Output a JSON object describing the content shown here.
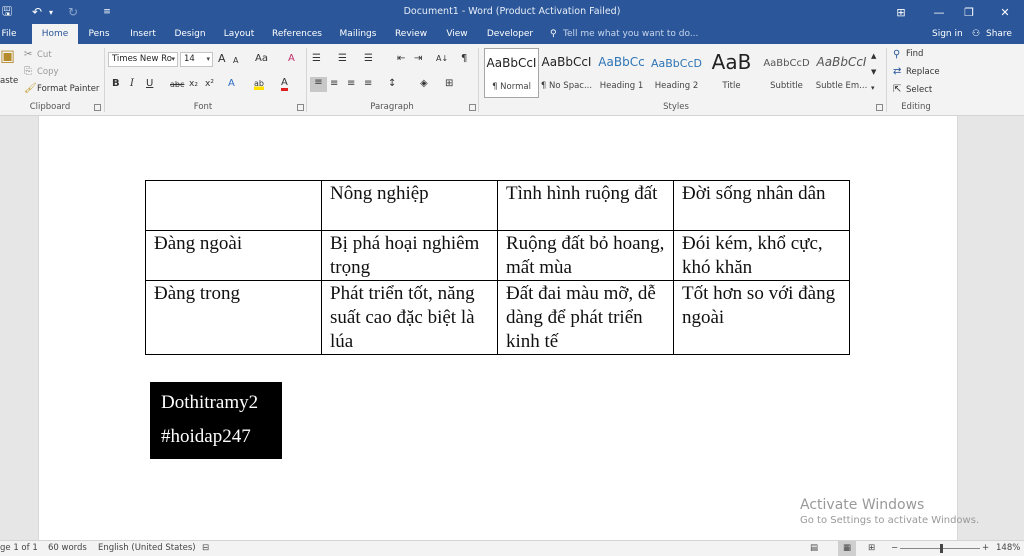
{
  "titlebar": {
    "doc_title": "Document1 - Word (Product Activation Failed)",
    "buttons": {
      "save": "🖫",
      "undo": "↶",
      "undo_arrow": "▾",
      "redo": "↻",
      "customize": "≡",
      "ribbon_display": "⊞",
      "minimize": "—",
      "restore": "❐",
      "close": "✕"
    }
  },
  "tabs": {
    "items": [
      "File",
      "Home",
      "Pens",
      "Insert",
      "Design",
      "Layout",
      "References",
      "Mailings",
      "Review",
      "View",
      "Developer"
    ],
    "tell_me": "Tell me what you want to do...",
    "sign_in": "Sign in",
    "share": "Share"
  },
  "ribbon": {
    "clipboard": {
      "paste": "aste",
      "cut": "Cut",
      "copy": "Copy",
      "format_painter": "Format Painter",
      "label": "Clipboard"
    },
    "font": {
      "font_name": "Times New Ro",
      "font_size": "14",
      "grow": "A",
      "shrink": "A",
      "case": "Aa",
      "clear": "A",
      "bold": "B",
      "italic": "I",
      "underline": "U",
      "strike": "abc",
      "subscript": "x₂",
      "superscript": "x²",
      "effects": "A",
      "highlight": "ab",
      "color": "A",
      "label": "Font"
    },
    "paragraph": {
      "bullets": "☰",
      "numbering": "☰",
      "multilevel": "☰",
      "decrease_indent": "⇤",
      "increase_indent": "⇥",
      "sort": "A↓",
      "pilcrow": "¶",
      "align_left": "≡",
      "center": "≡",
      "align_right": "≡",
      "justify": "≡",
      "line_spacing": "↕",
      "shading": "◈",
      "borders": "⊞",
      "label": "Paragraph"
    },
    "styles": {
      "items": [
        {
          "preview": "AaBbCcI",
          "name": "¶ Normal"
        },
        {
          "preview": "AaBbCcI",
          "name": "¶ No Spac..."
        },
        {
          "preview": "AaBbCc",
          "name": "Heading 1"
        },
        {
          "preview": "AaBbCcD",
          "name": "Heading 2"
        },
        {
          "preview": "AaB",
          "name": "Title"
        },
        {
          "preview": "AaBbCcD",
          "name": "Subtitle"
        },
        {
          "preview": "AaBbCcI",
          "name": "Subtle Em..."
        }
      ],
      "label": "Styles"
    },
    "editing": {
      "find": "Find",
      "replace": "Replace",
      "select": "Select",
      "label": "Editing"
    }
  },
  "document": {
    "table": [
      [
        "",
        "Nông nghiệp",
        "Tình hình ruộng đất",
        "Đời sống nhân dân"
      ],
      [
        "Đàng ngoài",
        "Bị phá hoại nghiêm trọng",
        "Ruộng đất bỏ hoang, mất mùa",
        "Đói kém, khổ cực, khó khăn"
      ],
      [
        "Đàng trong",
        "Phát triển tốt, năng suất cao đặc biệt là lúa",
        "Đất đai màu mỡ, dễ dàng để phát triển kinh tế",
        "Tốt hơn so với đàng ngoài"
      ]
    ],
    "watermark": {
      "line1": "Dothitramy2",
      "line2": "#hoidap247"
    }
  },
  "activation": {
    "line1": "Activate Windows",
    "line2": "Go to Settings to activate Windows."
  },
  "statusbar": {
    "page": "ge 1 of 1",
    "words": "60 words",
    "language": "English (United States)",
    "zoom": "148%",
    "zoom_minus": "−",
    "zoom_plus": "+"
  }
}
